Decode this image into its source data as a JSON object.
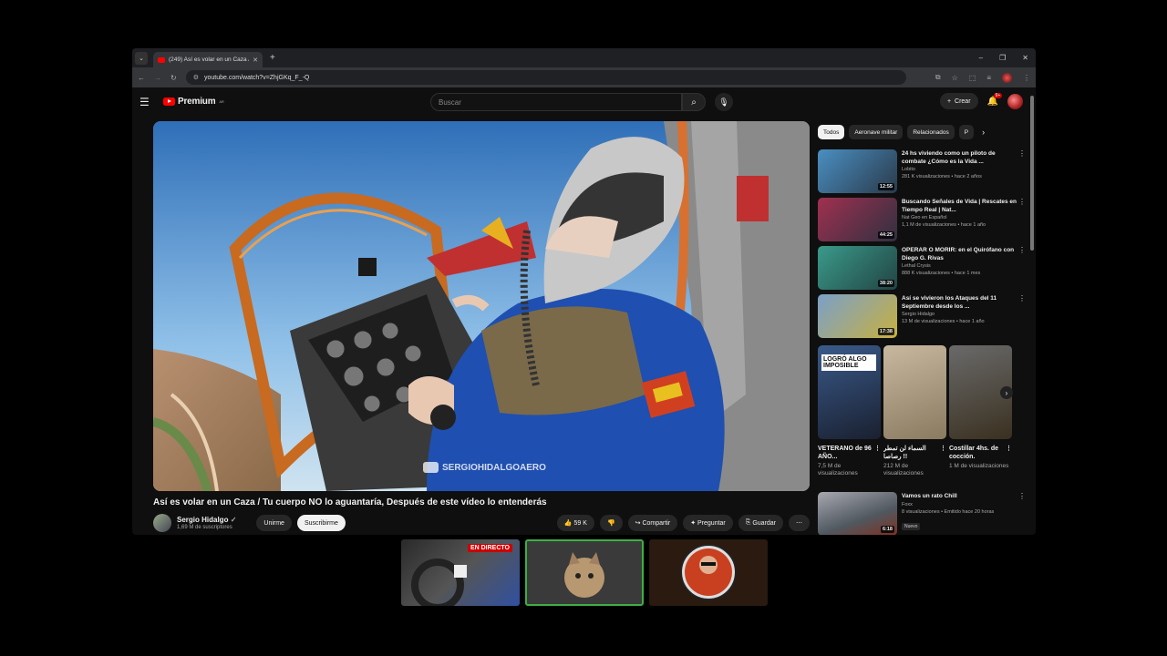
{
  "browser": {
    "tab_title": "(249) Así es volar en un Caza / ",
    "url": "youtube.com/watch?v=ZhjGKq_F_-Q",
    "extension_badge": "9+"
  },
  "header": {
    "logo_text": "Premium",
    "logo_sup": "AR",
    "search_placeholder": "Buscar",
    "create_label": "Crear",
    "notif_badge": "9+"
  },
  "video": {
    "watermark": "SERGIOHIDALGOAERO",
    "title": "Así es volar en un Caza / Tu cuerpo NO lo aguantaría, Después de este vídeo lo entenderás",
    "channel": "Sergio Hidalgo",
    "subscribers": "1,69 M de suscriptores",
    "join_label": "Unirme",
    "subscribe_label": "Suscribirme",
    "likes": "59 K",
    "share_label": "Compartir",
    "ask_label": "Preguntar",
    "save_label": "Guardar"
  },
  "chips": [
    "Todos",
    "Aeronave militar",
    "Relacionados",
    "P"
  ],
  "recommendations": [
    {
      "title": "24 hs viviendo como un piloto de combate ¿Cómo es la Vida ...",
      "channel": "Lobito",
      "meta": "281 K visualizaciones • hace 2 años",
      "duration": "12:55",
      "colors": [
        "#4a8fc2",
        "#2a3a4a"
      ]
    },
    {
      "title": "Buscando Señales de Vida | Rescates en Tiempo Real | Nat...",
      "channel": "Nat Geo en Español",
      "meta": "1,1 M de visualizaciones • hace 1 año",
      "duration": "44:25",
      "colors": [
        "#a03050",
        "#303040"
      ]
    },
    {
      "title": "OPERAR O MORIR: en el Quirófano con Diego G. Rivas",
      "channel": "Lethal Crysis",
      "meta": "888 K visualizaciones • hace 1 mes",
      "duration": "38:20",
      "colors": [
        "#3a9a8a",
        "#244"
      ]
    },
    {
      "title": "Así se vivieron los Ataques del 11 Septiembre desde los ...",
      "channel": "Sergio Hidalgo",
      "meta": "13 M de visualizaciones • hace 1 año",
      "duration": "17:38",
      "colors": [
        "#7aa0c8",
        "#c8b040"
      ]
    }
  ],
  "shorts": [
    {
      "title": "VETERANO de 96 AÑO...",
      "views": "7,5 M de visualizaciones",
      "overlay": "LOGRÓ ALGO IMPOSIBLE",
      "colors": [
        "#3a5a8a",
        "#1a2030"
      ]
    },
    {
      "title": "السماء لن تمطر رصاصا !!",
      "views": "212 M de visualizaciones",
      "colors": [
        "#c8b8a0",
        "#8a7a60"
      ]
    },
    {
      "title": "Costillar 4hs. de cocción.",
      "views": "1 M de visualizaciones",
      "colors": [
        "#6a6a6a",
        "#3a3020"
      ]
    }
  ],
  "last_rec": {
    "title": "Vamos un rato Chill",
    "channel": "Foxx",
    "meta": "8 visualizaciones • Emitido hace 20 horas",
    "badge": "Nuevo",
    "duration": "6:18"
  },
  "cams": {
    "live_label": "EN DIRECTO"
  }
}
